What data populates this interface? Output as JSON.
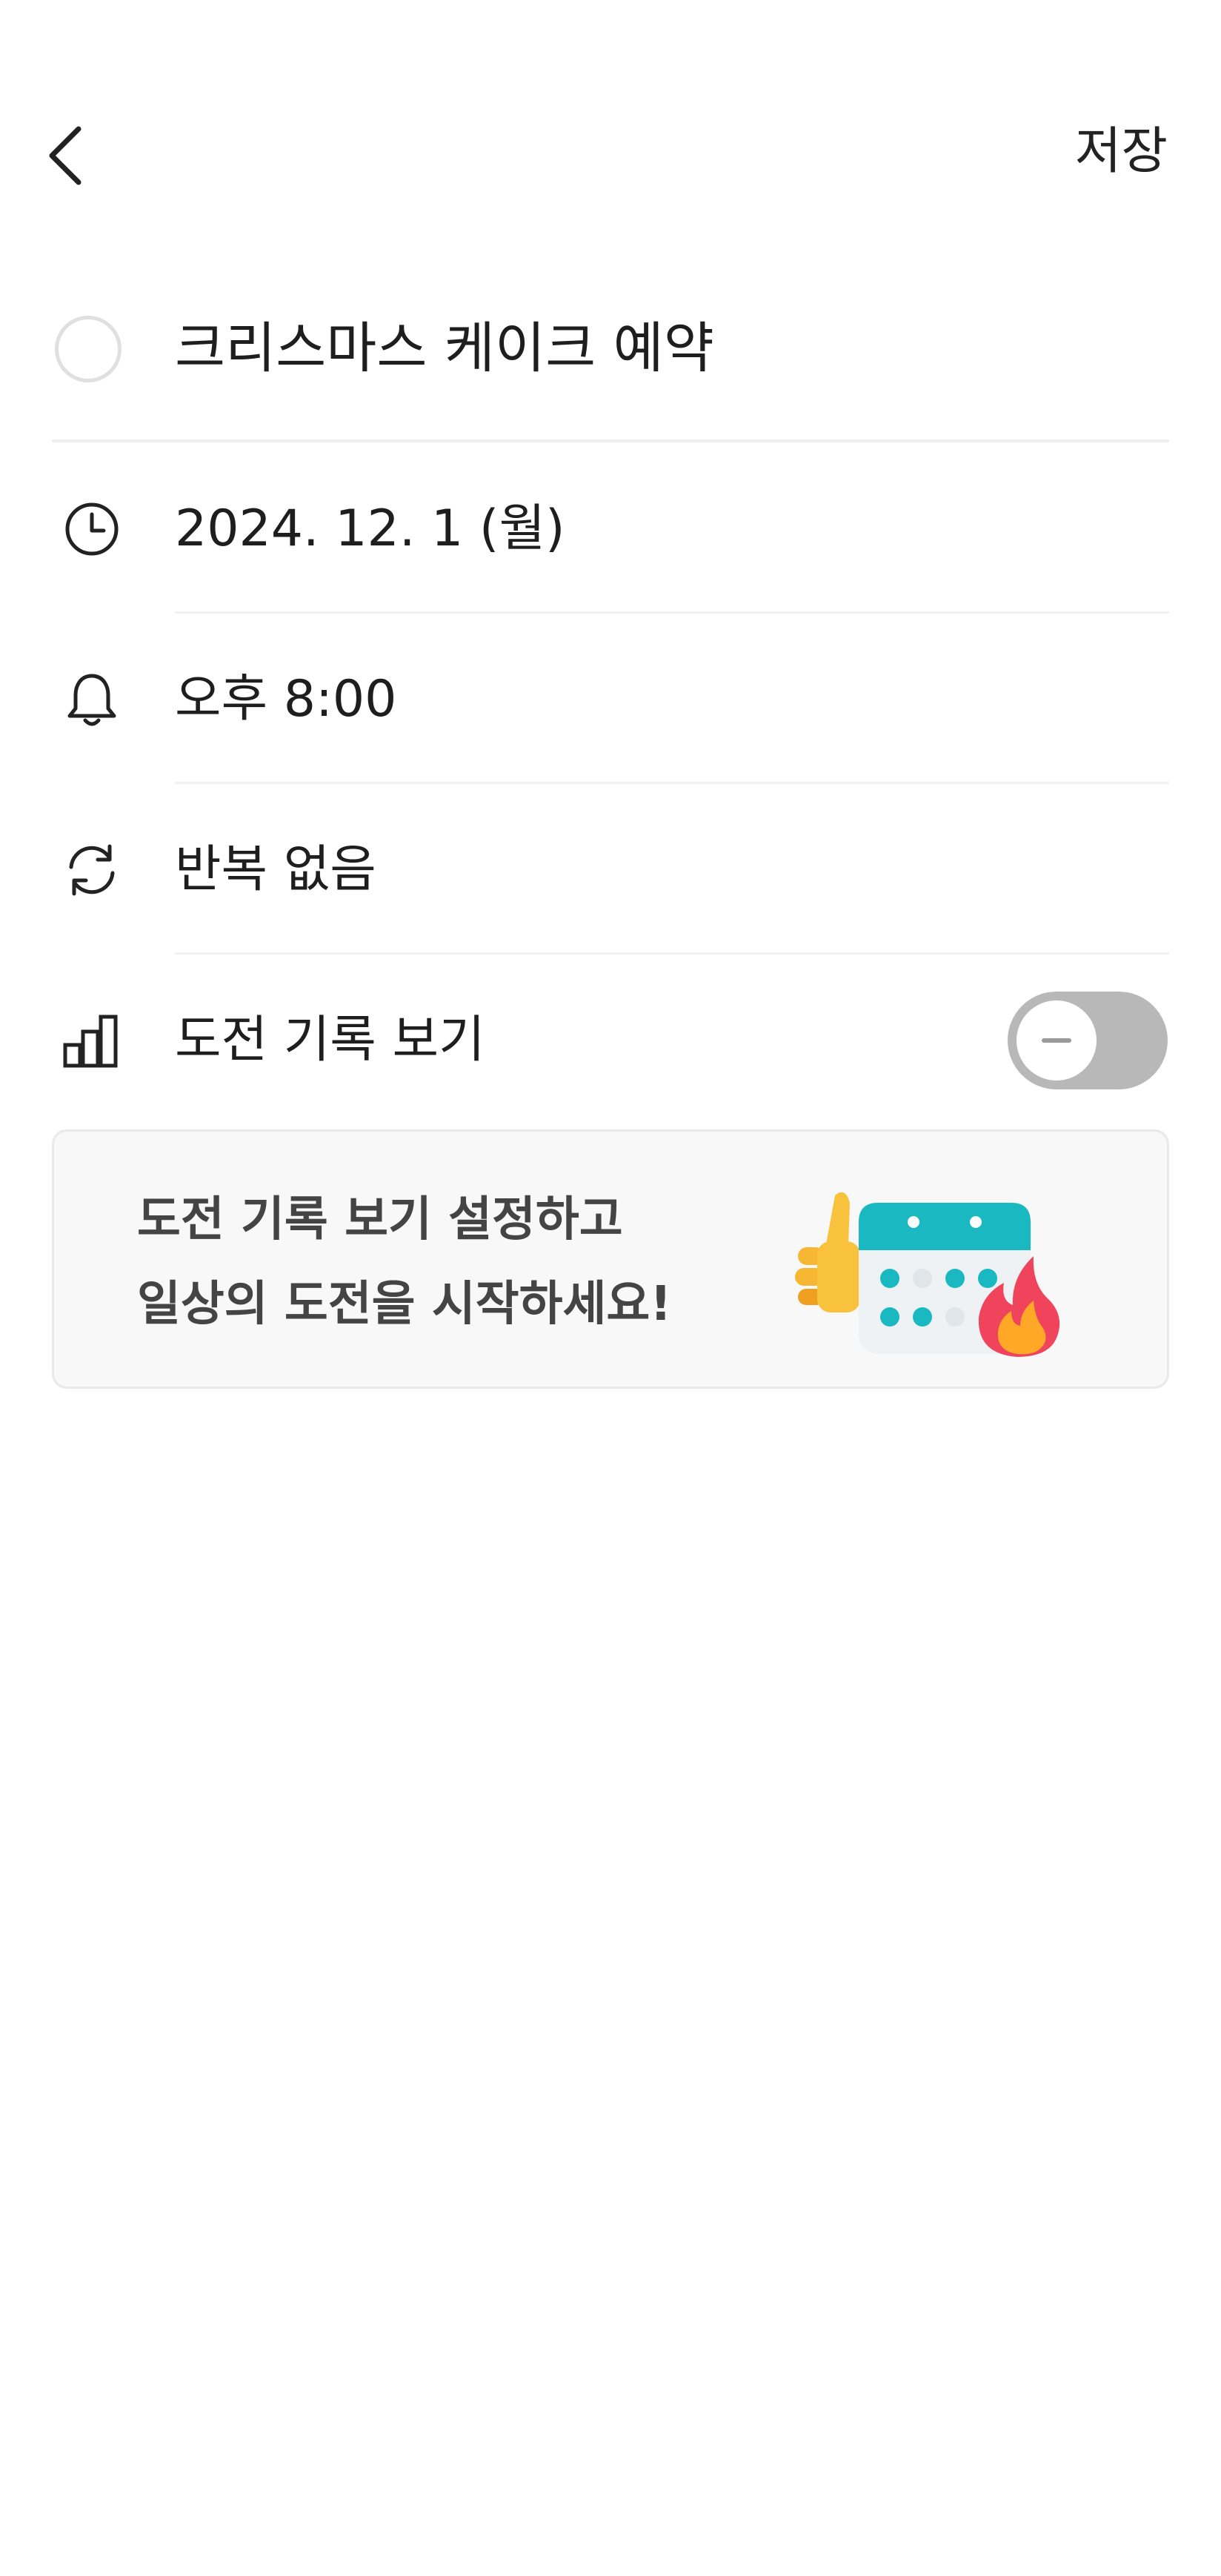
{
  "header": {
    "back_icon": "chevron-left-icon",
    "save_label": "저장"
  },
  "task": {
    "title": "크리스마스 케이크 예약",
    "completed": false
  },
  "rows": {
    "date": {
      "icon": "clock-icon",
      "label": "2024. 12. 1 (월)"
    },
    "alarm": {
      "icon": "bell-icon",
      "label": "오후 8:00"
    },
    "repeat": {
      "icon": "repeat-icon",
      "label": "반복 없음"
    },
    "challenge": {
      "icon": "bar-chart-icon",
      "label": "도전 기록 보기",
      "toggle_on": false
    }
  },
  "banner": {
    "line1": "도전 기록 보기 설정하고",
    "line2": "일상의 도전을 시작하세요!",
    "art": "thumbs-up-calendar-fire-illustration"
  },
  "colors": {
    "accent_teal": "#1ab8c0",
    "toggle_off": "#b8b8b8",
    "text_primary": "#1e1e1e",
    "banner_bg": "#f8f8f8"
  }
}
